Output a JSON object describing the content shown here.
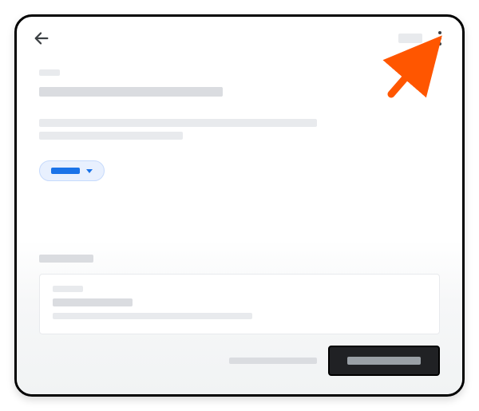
{
  "colors": {
    "accent": "#1a73e8",
    "arrow": "#ff5600",
    "placeholder_dark": "#dadce0",
    "placeholder_light": "#e8eaed",
    "button_bg": "#202124"
  },
  "header": {
    "back_label": "Back",
    "action_pill": "",
    "kebab_label": "More options"
  },
  "page": {
    "small_label": "",
    "title": "",
    "description_line1": "",
    "description_line2": ""
  },
  "dropdown": {
    "selected": ""
  },
  "section": {
    "label": ""
  },
  "card": {
    "label": "",
    "title": "",
    "description": ""
  },
  "footer": {
    "secondary_label": "",
    "primary_label": ""
  },
  "annotation": {
    "arrow_points_to": "kebab-menu"
  }
}
